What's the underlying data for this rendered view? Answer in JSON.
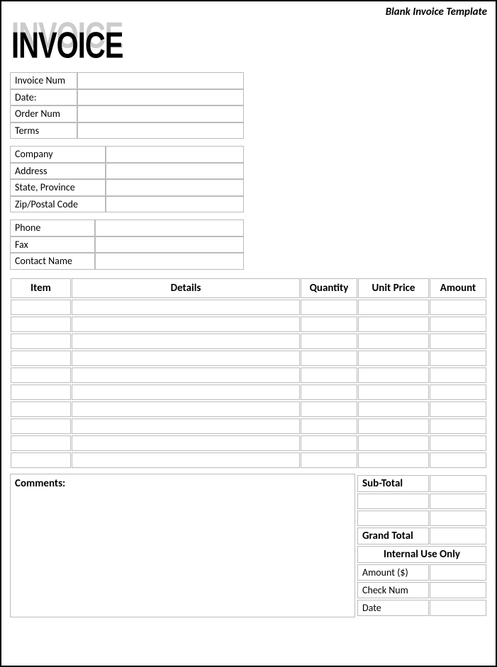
{
  "template_label": "Blank Invoice Template",
  "logo_text": "INVOICE",
  "blocks": {
    "invoice": [
      {
        "label": "Invoice Num",
        "value": ""
      },
      {
        "label": "Date:",
        "value": ""
      },
      {
        "label": "Order Num",
        "value": ""
      },
      {
        "label": "Terms",
        "value": ""
      }
    ],
    "company": [
      {
        "label": "Company",
        "value": ""
      },
      {
        "label": "Address",
        "value": ""
      },
      {
        "label": "State, Province",
        "value": ""
      },
      {
        "label": "Zip/Postal Code",
        "value": ""
      }
    ],
    "contact": [
      {
        "label": "Phone",
        "value": ""
      },
      {
        "label": "Fax",
        "value": ""
      },
      {
        "label": "Contact Name",
        "value": ""
      }
    ]
  },
  "items_table": {
    "headers": [
      "Item",
      "Details",
      "Quantity",
      "Unit Price",
      "Amount"
    ],
    "rows": [
      [
        "",
        "",
        "",
        "",
        ""
      ],
      [
        "",
        "",
        "",
        "",
        ""
      ],
      [
        "",
        "",
        "",
        "",
        ""
      ],
      [
        "",
        "",
        "",
        "",
        ""
      ],
      [
        "",
        "",
        "",
        "",
        ""
      ],
      [
        "",
        "",
        "",
        "",
        ""
      ],
      [
        "",
        "",
        "",
        "",
        ""
      ],
      [
        "",
        "",
        "",
        "",
        ""
      ],
      [
        "",
        "",
        "",
        "",
        ""
      ],
      [
        "",
        "",
        "",
        "",
        ""
      ]
    ]
  },
  "comments_label": "Comments:",
  "totals": {
    "subtotal_label": "Sub-Total",
    "subtotal_value": "",
    "extra_rows": [
      [
        "",
        ""
      ],
      [
        "",
        ""
      ]
    ],
    "grand_label": "Grand Total",
    "grand_value": "",
    "internal_header": "Internal Use Only",
    "internal_rows": [
      {
        "label": "Amount ($)",
        "value": ""
      },
      {
        "label": "Check Num",
        "value": ""
      },
      {
        "label": "Date",
        "value": ""
      }
    ]
  }
}
